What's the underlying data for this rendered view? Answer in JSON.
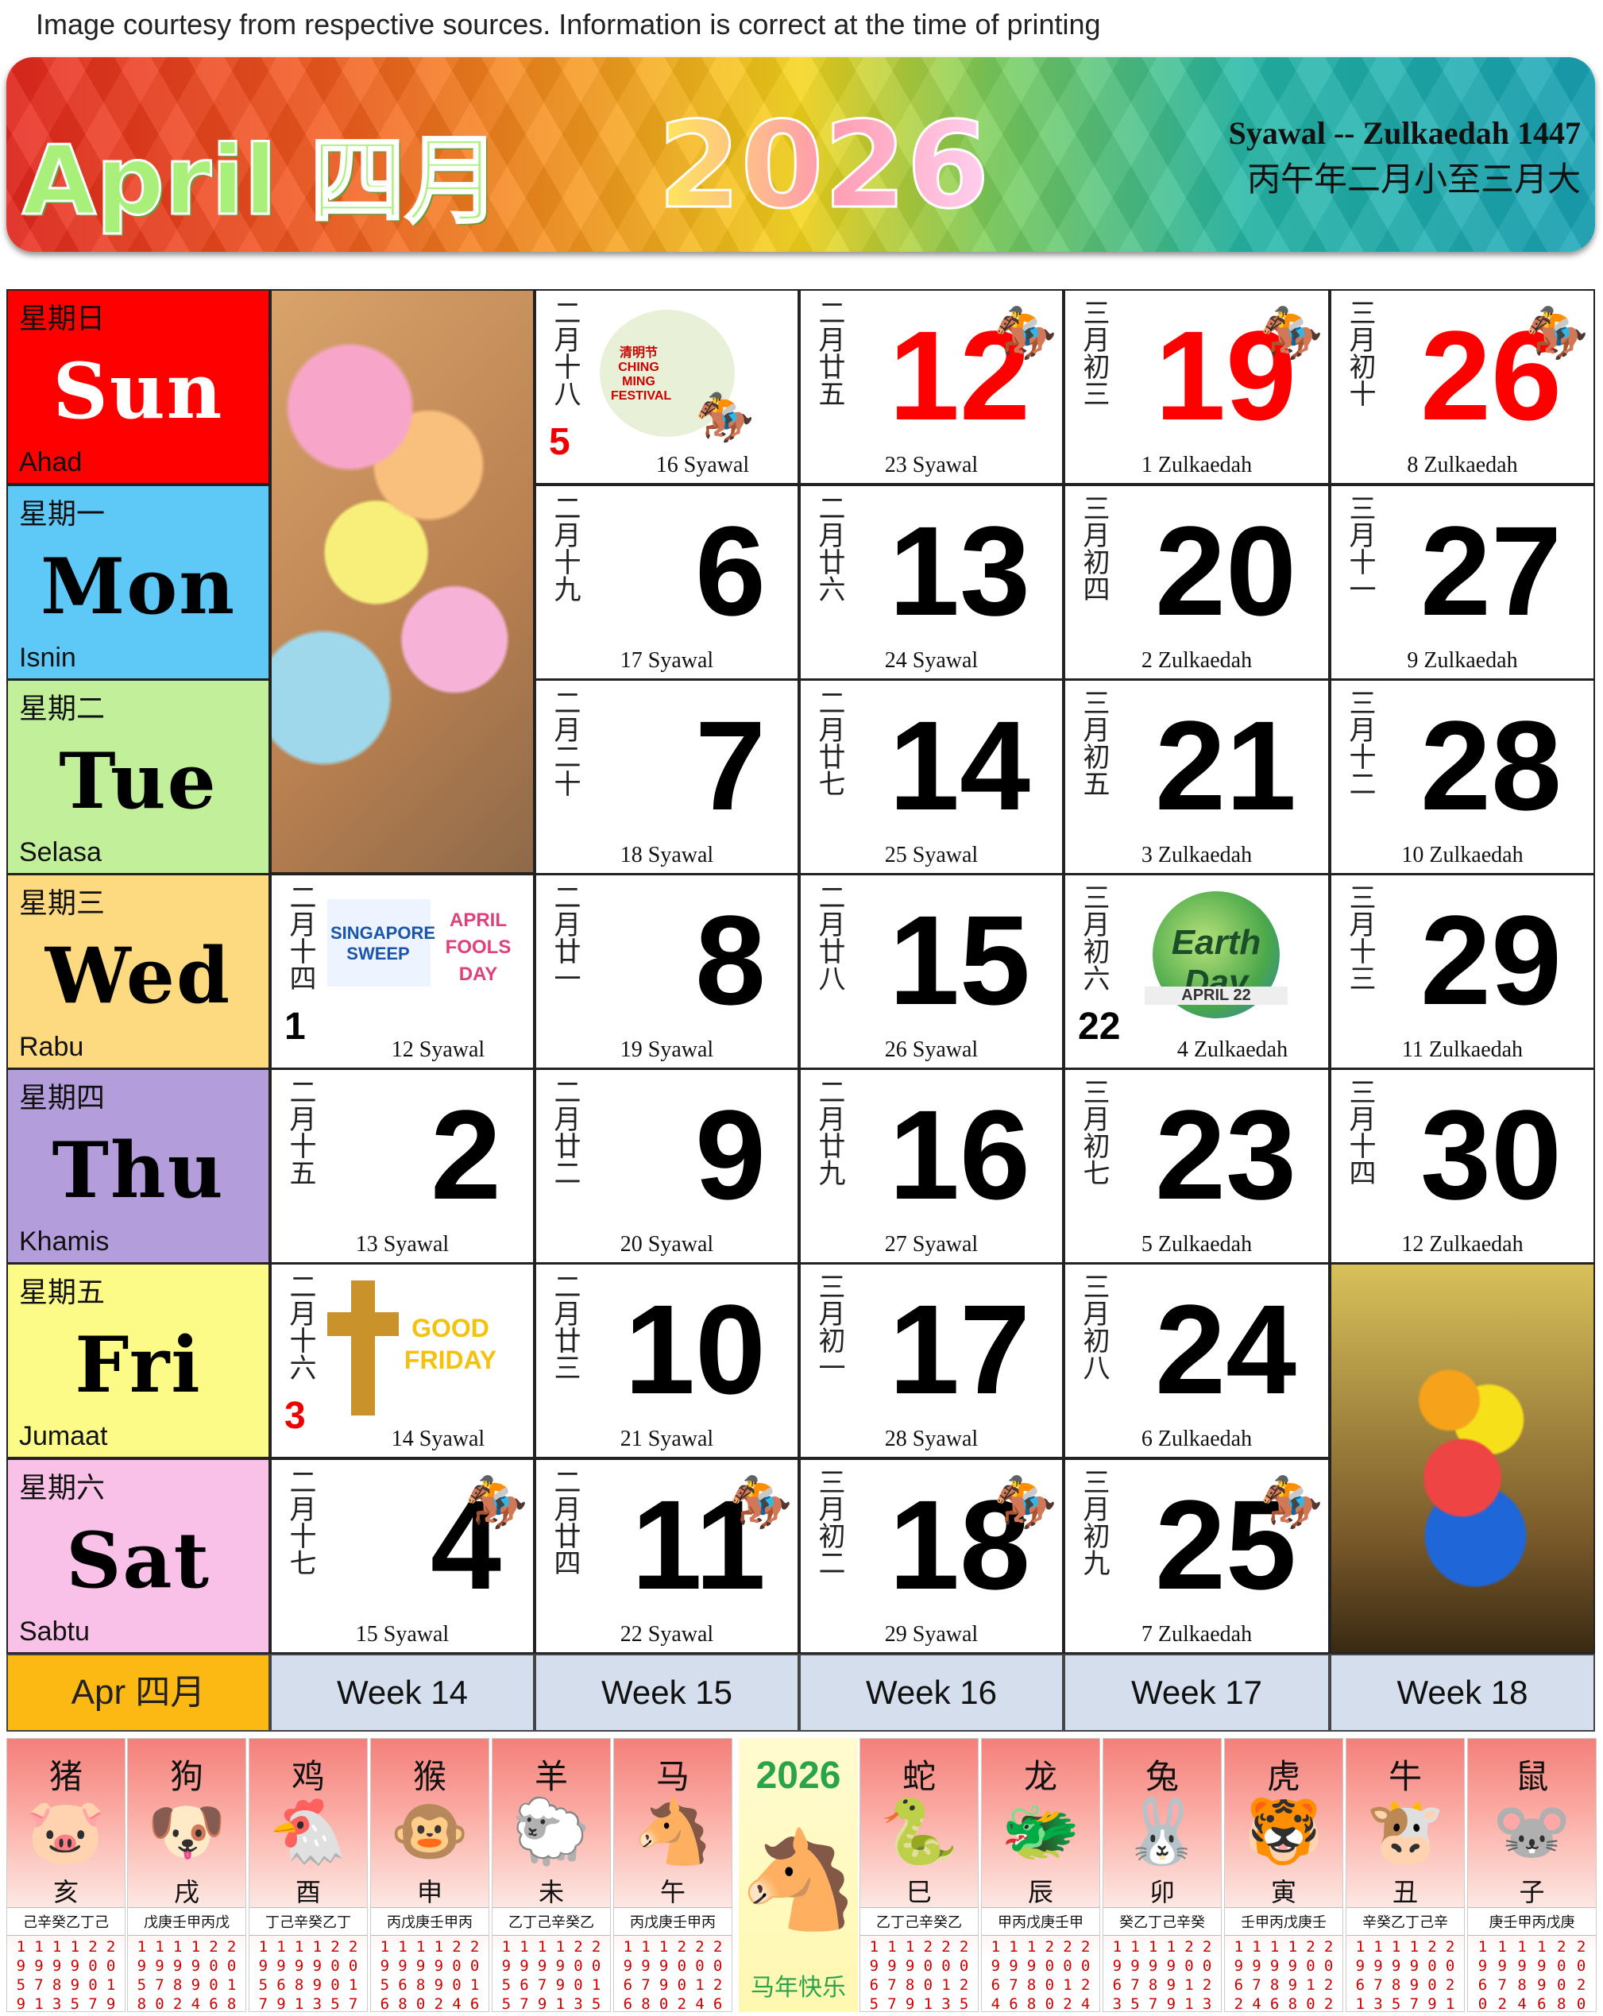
{
  "courtesy": "Image courtesy from respective sources. Information is correct at the time of printing",
  "header": {
    "month": "April 四月",
    "year": "2026",
    "islamic": "Syawal -- Zulkaedah 1447",
    "lunar": "丙午年二月小至三月大"
  },
  "days": [
    {
      "cn": "星期日",
      "en": "Sun",
      "my": "Ahad",
      "color": "#fe0000"
    },
    {
      "cn": "星期一",
      "en": "Mon",
      "my": "Isnin",
      "color": "#5ec8f7"
    },
    {
      "cn": "星期二",
      "en": "Tue",
      "my": "Selasa",
      "color": "#c2f09a"
    },
    {
      "cn": "星期三",
      "en": "Wed",
      "my": "Rabu",
      "color": "#fdd980"
    },
    {
      "cn": "星期四",
      "en": "Thu",
      "my": "Khamis",
      "color": "#b39ddb"
    },
    {
      "cn": "星期五",
      "en": "Fri",
      "my": "Jumaat",
      "color": "#fdfb88"
    },
    {
      "cn": "星期六",
      "en": "Sat",
      "my": "Sabtu",
      "color": "#f9c0e8"
    }
  ],
  "cells": {
    "d1": {
      "day": "1",
      "lunar": "二月十四",
      "isl": "12 Syawal"
    },
    "d2": {
      "day": "2",
      "lunar": "二月十五",
      "isl": "13 Syawal"
    },
    "d3": {
      "day": "3",
      "lunar": "二月十六",
      "isl": "14 Syawal"
    },
    "d4": {
      "day": "4",
      "lunar": "二月十七",
      "isl": "15 Syawal"
    },
    "d5": {
      "day": "5",
      "lunar": "二月十八",
      "isl": "16 Syawal"
    },
    "d6": {
      "day": "6",
      "lunar": "二月十九",
      "isl": "17 Syawal"
    },
    "d7": {
      "day": "7",
      "lunar": "二月二十",
      "isl": "18 Syawal"
    },
    "d8": {
      "day": "8",
      "lunar": "二月廿一",
      "isl": "19 Syawal"
    },
    "d9": {
      "day": "9",
      "lunar": "二月廿二",
      "isl": "20 Syawal"
    },
    "d10": {
      "day": "10",
      "lunar": "二月廿三",
      "isl": "21 Syawal"
    },
    "d11": {
      "day": "11",
      "lunar": "二月廿四",
      "isl": "22 Syawal"
    },
    "d12": {
      "day": "12",
      "lunar": "二月廿五",
      "isl": "23 Syawal"
    },
    "d13": {
      "day": "13",
      "lunar": "二月廿六",
      "isl": "24 Syawal"
    },
    "d14": {
      "day": "14",
      "lunar": "二月廿七",
      "isl": "25 Syawal"
    },
    "d15": {
      "day": "15",
      "lunar": "二月廿八",
      "isl": "26 Syawal"
    },
    "d16": {
      "day": "16",
      "lunar": "二月廿九",
      "isl": "27 Syawal"
    },
    "d17": {
      "day": "17",
      "lunar": "三月初一",
      "isl": "28 Syawal"
    },
    "d18": {
      "day": "18",
      "lunar": "三月初二",
      "isl": "29 Syawal"
    },
    "d19": {
      "day": "19",
      "lunar": "三月初三",
      "isl": "1 Zulkaedah"
    },
    "d20": {
      "day": "20",
      "lunar": "三月初四",
      "isl": "2 Zulkaedah"
    },
    "d21": {
      "day": "21",
      "lunar": "三月初五",
      "isl": "3 Zulkaedah"
    },
    "d22": {
      "day": "22",
      "lunar": "三月初六",
      "isl": "4 Zulkaedah"
    },
    "d23": {
      "day": "23",
      "lunar": "三月初七",
      "isl": "5 Zulkaedah"
    },
    "d24": {
      "day": "24",
      "lunar": "三月初八",
      "isl": "6 Zulkaedah"
    },
    "d25": {
      "day": "25",
      "lunar": "三月初九",
      "isl": "7 Zulkaedah"
    },
    "d26": {
      "day": "26",
      "lunar": "三月初十",
      "isl": "8 Zulkaedah"
    },
    "d27": {
      "day": "27",
      "lunar": "三月十一",
      "isl": "9 Zulkaedah"
    },
    "d28": {
      "day": "28",
      "lunar": "三月十二",
      "isl": "10 Zulkaedah"
    },
    "d29": {
      "day": "29",
      "lunar": "三月十三",
      "isl": "11 Zulkaedah"
    },
    "d30": {
      "day": "30",
      "lunar": "三月十四",
      "isl": "12 Zulkaedah"
    }
  },
  "events": {
    "ching_ming": "清明节 CHING MING FESTIVAL",
    "sg_sweep": "SINGAPORE SWEEP",
    "fools": "APRIL FOOLS DAY",
    "good_friday": "GOOD FRIDAY",
    "earth_day": "Earth Day",
    "earth_date": "APRIL 22"
  },
  "footer": {
    "apr": "Apr 四月",
    "weeks": [
      "Week 14",
      "Week 15",
      "Week 16",
      "Week 17",
      "Week 18"
    ]
  },
  "zodiac": [
    {
      "name": "猪",
      "branch": "亥",
      "stems": "己辛癸乙丁己",
      "years": [
        [
          "1",
          "9",
          "5",
          "9"
        ],
        [
          "1",
          "9",
          "7",
          "1"
        ],
        [
          "1",
          "9",
          "8",
          "3"
        ],
        [
          "1",
          "9",
          "9",
          "5"
        ],
        [
          "2",
          "0",
          "0",
          "7"
        ],
        [
          "2",
          "0",
          "1",
          "9"
        ]
      ]
    },
    {
      "name": "狗",
      "branch": "戌",
      "stems": "戊庚壬甲丙戊",
      "years": [
        [
          "1",
          "9",
          "5",
          "8"
        ],
        [
          "1",
          "9",
          "7",
          "0"
        ],
        [
          "1",
          "9",
          "8",
          "2"
        ],
        [
          "1",
          "9",
          "9",
          "4"
        ],
        [
          "2",
          "0",
          "0",
          "6"
        ],
        [
          "2",
          "0",
          "1",
          "8"
        ]
      ]
    },
    {
      "name": "鸡",
      "branch": "酉",
      "stems": "丁己辛癸乙丁",
      "years": [
        [
          "1",
          "9",
          "5",
          "7"
        ],
        [
          "1",
          "9",
          "6",
          "9"
        ],
        [
          "1",
          "9",
          "8",
          "1"
        ],
        [
          "1",
          "9",
          "9",
          "3"
        ],
        [
          "2",
          "0",
          "0",
          "5"
        ],
        [
          "2",
          "0",
          "1",
          "7"
        ]
      ]
    },
    {
      "name": "猴",
      "branch": "申",
      "stems": "丙戊庚壬甲丙",
      "years": [
        [
          "1",
          "9",
          "5",
          "6"
        ],
        [
          "1",
          "9",
          "6",
          "8"
        ],
        [
          "1",
          "9",
          "8",
          "0"
        ],
        [
          "1",
          "9",
          "9",
          "2"
        ],
        [
          "2",
          "0",
          "0",
          "4"
        ],
        [
          "2",
          "0",
          "1",
          "6"
        ]
      ]
    },
    {
      "name": "羊",
      "branch": "未",
      "stems": "乙丁己辛癸乙",
      "years": [
        [
          "1",
          "9",
          "5",
          "5"
        ],
        [
          "1",
          "9",
          "6",
          "7"
        ],
        [
          "1",
          "9",
          "7",
          "9"
        ],
        [
          "1",
          "9",
          "9",
          "1"
        ],
        [
          "2",
          "0",
          "0",
          "3"
        ],
        [
          "2",
          "0",
          "1",
          "5"
        ]
      ]
    },
    {
      "name": "马",
      "branch": "午",
      "stems": "丙戊庚壬甲丙",
      "years": [
        [
          "1",
          "9",
          "6",
          "6"
        ],
        [
          "1",
          "9",
          "7",
          "8"
        ],
        [
          "1",
          "9",
          "9",
          "0"
        ],
        [
          "2",
          "0",
          "0",
          "2"
        ],
        [
          "2",
          "0",
          "1",
          "4"
        ],
        [
          "2",
          "0",
          "2",
          "6"
        ]
      ]
    },
    {
      "name": "蛇",
      "branch": "巳",
      "stems": "乙丁己辛癸乙",
      "years": [
        [
          "1",
          "9",
          "6",
          "5"
        ],
        [
          "1",
          "9",
          "7",
          "7"
        ],
        [
          "1",
          "9",
          "8",
          "9"
        ],
        [
          "2",
          "0",
          "0",
          "1"
        ],
        [
          "2",
          "0",
          "1",
          "3"
        ],
        [
          "2",
          "0",
          "2",
          "5"
        ]
      ]
    },
    {
      "name": "龙",
      "branch": "辰",
      "stems": "甲丙戊庚壬甲",
      "years": [
        [
          "1",
          "9",
          "6",
          "4"
        ],
        [
          "1",
          "9",
          "7",
          "6"
        ],
        [
          "1",
          "9",
          "8",
          "8"
        ],
        [
          "2",
          "0",
          "0",
          "0"
        ],
        [
          "2",
          "0",
          "1",
          "2"
        ],
        [
          "2",
          "0",
          "2",
          "4"
        ]
      ]
    },
    {
      "name": "兔",
      "branch": "卯",
      "stems": "癸乙丁己辛癸",
      "years": [
        [
          "1",
          "9",
          "6",
          "3"
        ],
        [
          "1",
          "9",
          "7",
          "5"
        ],
        [
          "1",
          "9",
          "8",
          "7"
        ],
        [
          "1",
          "9",
          "9",
          "9"
        ],
        [
          "2",
          "0",
          "1",
          "1"
        ],
        [
          "2",
          "0",
          "2",
          "3"
        ]
      ]
    },
    {
      "name": "虎",
      "branch": "寅",
      "stems": "壬甲丙戊庚壬",
      "years": [
        [
          "1",
          "9",
          "6",
          "2"
        ],
        [
          "1",
          "9",
          "7",
          "4"
        ],
        [
          "1",
          "9",
          "8",
          "6"
        ],
        [
          "1",
          "9",
          "9",
          "8"
        ],
        [
          "2",
          "0",
          "1",
          "0"
        ],
        [
          "2",
          "0",
          "2",
          "2"
        ]
      ]
    },
    {
      "name": "牛",
      "branch": "丑",
      "stems": "辛癸乙丁己辛",
      "years": [
        [
          "1",
          "9",
          "6",
          "1"
        ],
        [
          "1",
          "9",
          "7",
          "3"
        ],
        [
          "1",
          "9",
          "8",
          "5"
        ],
        [
          "1",
          "9",
          "9",
          "7"
        ],
        [
          "2",
          "0",
          "0",
          "9"
        ],
        [
          "2",
          "0",
          "2",
          "1"
        ]
      ]
    },
    {
      "name": "鼠",
      "branch": "子",
      "stems": "庚壬甲丙戊庚",
      "years": [
        [
          "1",
          "9",
          "6",
          "0"
        ],
        [
          "1",
          "9",
          "7",
          "2"
        ],
        [
          "1",
          "9",
          "8",
          "4"
        ],
        [
          "1",
          "9",
          "9",
          "6"
        ],
        [
          "2",
          "0",
          "0",
          "8"
        ],
        [
          "2",
          "0",
          "2",
          "0"
        ]
      ]
    }
  ],
  "zodiac_center": {
    "year": "2026",
    "greeting": "马年快乐"
  },
  "icons": {
    "horse": "horse-racing-icon"
  }
}
